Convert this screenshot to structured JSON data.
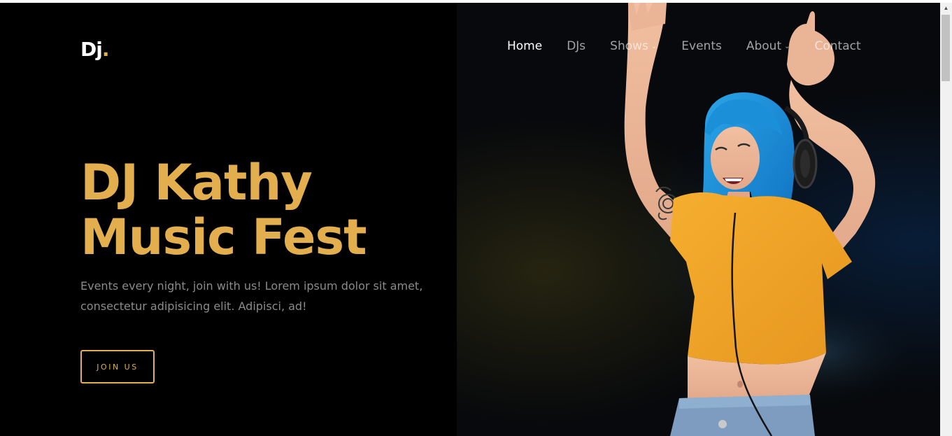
{
  "brand": {
    "logo_text": "Dj",
    "logo_dot": "."
  },
  "nav": {
    "items": [
      {
        "label": "Home",
        "active": true
      },
      {
        "label": "DJs"
      },
      {
        "label": "Shows",
        "has_dropdown": true
      },
      {
        "label": "Events"
      },
      {
        "label": "About",
        "has_dropdown": true
      },
      {
        "label": "Contact"
      }
    ]
  },
  "hero": {
    "title_line1": "DJ Kathy",
    "title_line2": "Music Fest",
    "description": "Events every night, join with us! Lorem ipsum dolor sit amet, consectetur adipisicing elit. Adipisci, ad!",
    "cta_label": "JOIN US"
  },
  "colors": {
    "accent": "#e2ae4e",
    "background": "#000000",
    "text_muted": "#8b8b8b",
    "shirt": "#f2a72c",
    "hair": "#1f8ed6"
  },
  "icons": {
    "dropdown": "chevron-down-icon",
    "scroll_up": "arrow-up-icon"
  }
}
